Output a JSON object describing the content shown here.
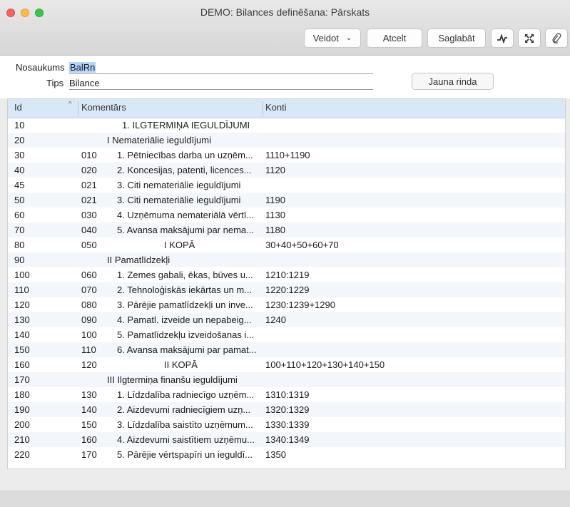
{
  "window": {
    "title": "DEMO: Bilances definēšana: Pārskats"
  },
  "toolbar": {
    "create_label": "Veidot",
    "cancel_label": "Atcelt",
    "save_label": "Saglabāt",
    "icons": [
      "activity-icon",
      "expand-icon",
      "paperclip-icon"
    ]
  },
  "form": {
    "name_label": "Nosaukums",
    "name_value": "BalRn",
    "type_label": "Tips",
    "type_value": "Bilance",
    "new_row_label": "Jauna rinda"
  },
  "table": {
    "columns": {
      "id": "Id",
      "comment": "Komentārs",
      "accounts": "Konti"
    },
    "sort_indicator": "^",
    "rows": [
      {
        "id": "10",
        "code": "",
        "text": "1. ILGTERMIŅA IEGULDĪJUMI",
        "konti": ""
      },
      {
        "id": "20",
        "code": "",
        "text": "I Nemateriālie ieguldījumi",
        "konti": ""
      },
      {
        "id": "30",
        "code": "010",
        "text": "1. Pētniecības darba un uzņēm...",
        "konti": "1110+1190"
      },
      {
        "id": "40",
        "code": "020",
        "text": "2. Koncesijas, patenti, licences...",
        "konti": "1120"
      },
      {
        "id": "45",
        "code": "021",
        "text": "3. Citi nemateriālie ieguldījumi",
        "konti": ""
      },
      {
        "id": "50",
        "code": "021",
        "text": "3. Citi nemateriālie ieguldījumi",
        "konti": "1190"
      },
      {
        "id": "60",
        "code": "030",
        "text": "4. Uzņēmuma nemateriālā vērtī...",
        "konti": "1130"
      },
      {
        "id": "70",
        "code": "040",
        "text": "5. Avansa maksājumi par nema...",
        "konti": "1180"
      },
      {
        "id": "80",
        "code": "050",
        "text": "I KOPĀ",
        "konti": "30+40+50+60+70"
      },
      {
        "id": "90",
        "code": "",
        "text": "II Pamatlīdzekļi",
        "konti": ""
      },
      {
        "id": "100",
        "code": "060",
        "text": "1. Zemes gabali, ēkas, būves u...",
        "konti": "1210:1219"
      },
      {
        "id": "110",
        "code": "070",
        "text": "2. Tehnoloģiskās iekārtas un m...",
        "konti": "1220:1229"
      },
      {
        "id": "120",
        "code": "080",
        "text": "3. Pārējie pamatlīdzekļi un inve...",
        "konti": "1230:1239+1290"
      },
      {
        "id": "130",
        "code": "090",
        "text": "4. Pamatl. izveide un nepabeig...",
        "konti": "1240"
      },
      {
        "id": "140",
        "code": "100",
        "text": "5. Pamatlīdzekļu izveidošanas i...",
        "konti": ""
      },
      {
        "id": "150",
        "code": "110",
        "text": "6. Avansa maksājumi par pamat...",
        "konti": ""
      },
      {
        "id": "160",
        "code": "120",
        "text": "II KOPĀ",
        "konti": "100+110+120+130+140+150"
      },
      {
        "id": "170",
        "code": "",
        "text": "III Ilgtermiņa finanšu ieguldījumi",
        "konti": ""
      },
      {
        "id": "180",
        "code": "130",
        "text": "1. Līdzdalība radniecīgo uzņēm...",
        "konti": "1310:1319"
      },
      {
        "id": "190",
        "code": "140",
        "text": "2. Aizdevumi radniecīgiem uzņ...",
        "konti": "1320:1329"
      },
      {
        "id": "200",
        "code": "150",
        "text": "3. Līdzdalība saistīto uzņēmum...",
        "konti": "1330:1339"
      },
      {
        "id": "210",
        "code": "160",
        "text": "4. Aizdevumi saistītiem uzņēmu...",
        "konti": "1340:1349"
      },
      {
        "id": "220",
        "code": "170",
        "text": "5. Pārējie vērtspapīri un ieguldī...",
        "konti": "1350"
      }
    ]
  }
}
